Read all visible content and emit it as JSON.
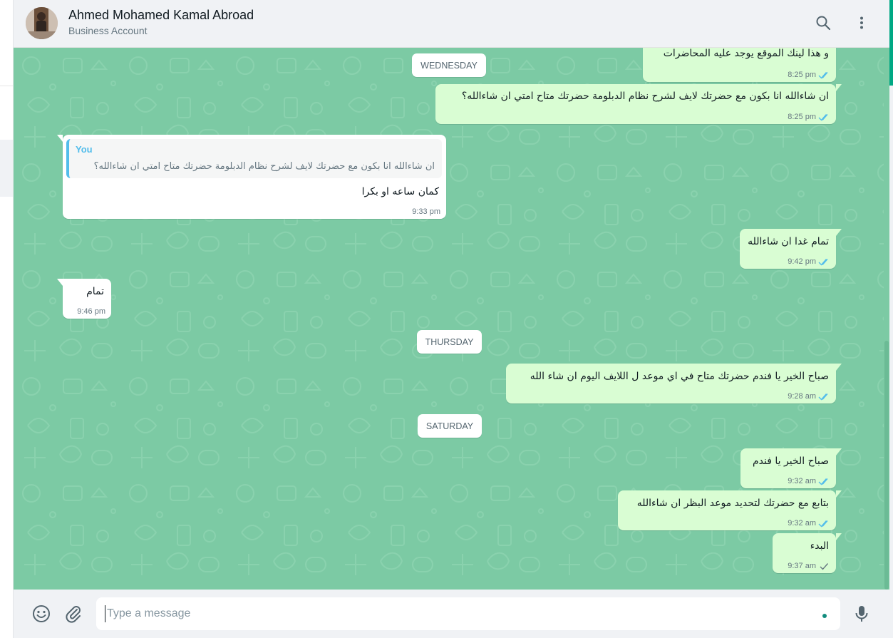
{
  "header": {
    "contact_name": "Ahmed Mohamed Kamal Abroad",
    "contact_sub": "Business Account",
    "icons": [
      "search-icon",
      "menu-icon"
    ]
  },
  "colors": {
    "chat_bg": "#7ccaa4",
    "outgoing_bubble": "#d9fdd3",
    "incoming_bubble": "#ffffff",
    "read_tick": "#53bdeb",
    "sent_tick": "#667781",
    "accent": "#00a884"
  },
  "days": {
    "wednesday": "WEDNESDAY",
    "thursday": "THURSDAY",
    "saturday": "SATURDAY"
  },
  "messages": [
    {
      "dir": "out",
      "text": "و هذا لينك الموقع يوجد عليه المحاضرات",
      "time": "8:25 pm",
      "status": "read"
    },
    {
      "dir": "out",
      "text": "ان شاءالله انا بكون مع حضرتك لايف لشرح نظام الدبلومة حضرتك متاح امتي ان شاءالله؟",
      "time": "8:25 pm",
      "status": "read"
    },
    {
      "dir": "in",
      "quote_author": "You",
      "quote_text": "ان شاءالله انا بكون مع حضرتك لايف لشرح نظام الدبلومة حضرتك متاح امتي ان شاءالله؟",
      "text": "كمان ساعه او بكرا",
      "time": "9:33 pm"
    },
    {
      "dir": "out",
      "text": "تمام غدا ان شاءالله",
      "time": "9:42 pm",
      "status": "read"
    },
    {
      "dir": "in",
      "text": "تمام",
      "time": "9:46 pm"
    },
    {
      "dir": "out",
      "text": "صباح الخير يا فندم حضرتك متاح في اي موعد ل اللايف اليوم ان شاء الله",
      "time": "9:28 am",
      "status": "read"
    },
    {
      "dir": "out",
      "text": "صباح الخير يا فندم",
      "time": "9:32 am",
      "status": "read"
    },
    {
      "dir": "out",
      "text": "بتابع مع حضرتك لتحديد موعد البظر ان شاءالله",
      "time": "9:32 am",
      "status": "read"
    },
    {
      "dir": "out",
      "text": "البدء",
      "time": "9:37 am",
      "status": "sent"
    }
  ],
  "footer": {
    "placeholder": "Type a message",
    "icons": [
      "emoji-icon",
      "attach-icon",
      "mic-icon"
    ]
  }
}
